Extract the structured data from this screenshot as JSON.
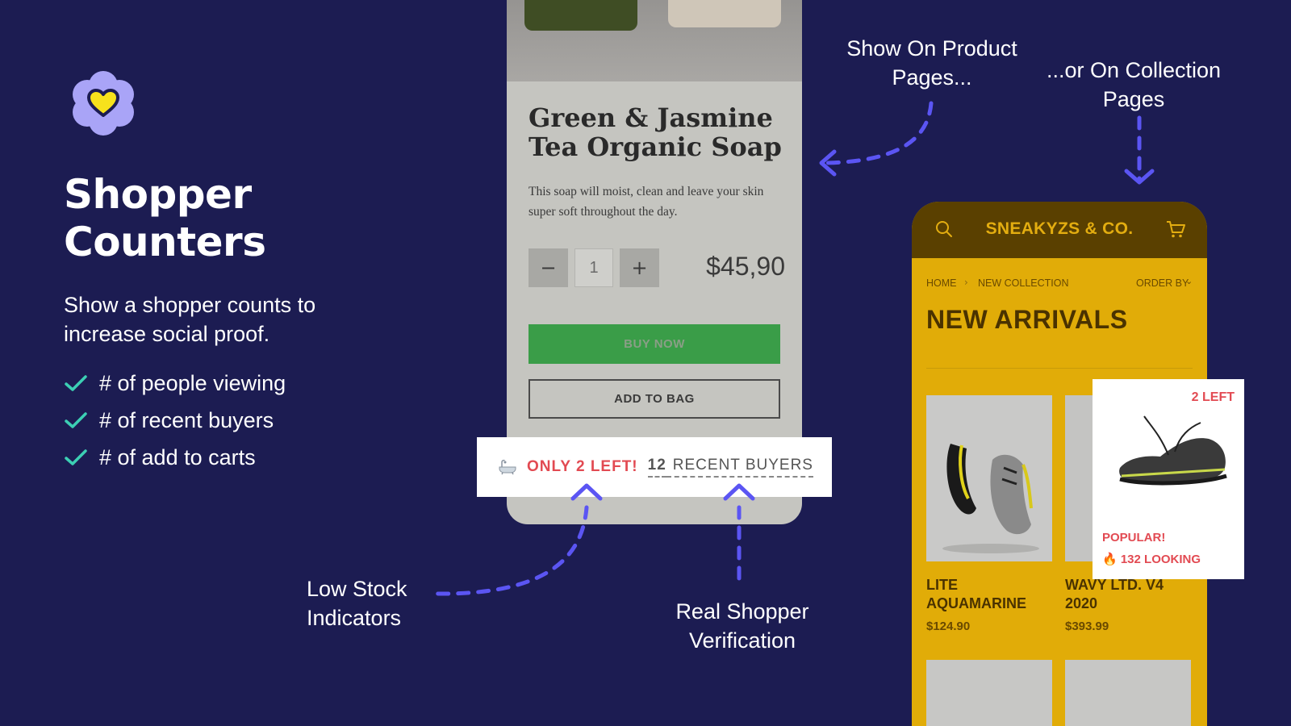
{
  "colors": {
    "background": "#1c1c52",
    "accent": "#5b55f3",
    "check": "#3ccfb4",
    "alert": "#e24a52",
    "buy_button": "#3a9d48",
    "store_yellow": "#e1ac08",
    "store_brown": "#5a4000"
  },
  "hero": {
    "logo_icon": "flower-heart-icon",
    "title": "Shopper Counters",
    "subtitle": "Show a shopper counts to increase social proof.",
    "features": [
      "# of people viewing",
      "# of recent buyers",
      "# of add to carts"
    ]
  },
  "product_page": {
    "name": "Green & Jasmine Tea Organic Soap",
    "description": "This soap will moist, clean and leave your skin super soft throughout the day.",
    "quantity": "1",
    "minus_label": "−",
    "plus_label": "+",
    "price": "$45,90",
    "buy_now": "BUY NOW",
    "add_to_bag": "ADD TO BAG"
  },
  "counter_bar": {
    "icon": "bathtub-icon",
    "low_stock": "ONLY 2 LEFT!",
    "buyers_count": "12",
    "buyers_label": "RECENT BUYERS"
  },
  "collection_page": {
    "store_name": "SNEAKYZS & CO.",
    "breadcrumb": [
      "HOME",
      "NEW COLLECTION"
    ],
    "order_by": "ORDER BY",
    "title": "NEW ARRIVALS",
    "products": [
      {
        "name": "LITE AQUAMARINE",
        "price": "$124.90"
      },
      {
        "name": "WAVY LTD. V4 2020",
        "price": "$393.99"
      }
    ]
  },
  "popup": {
    "stock": "2 LEFT",
    "popular": "POPULAR!",
    "looking": "🔥 132 LOOKING"
  },
  "captions": {
    "product_pages": "Show On Product Pages...",
    "collection_pages": "...or On Collection Pages",
    "low_stock": "Low Stock Indicators",
    "verification": "Real Shopper Verification"
  }
}
